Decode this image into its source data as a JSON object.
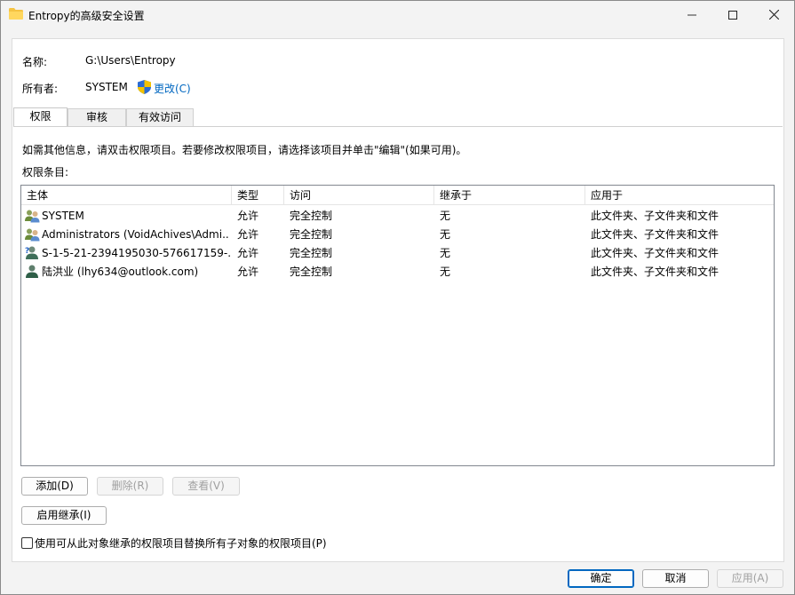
{
  "window": {
    "title": "Entropy的高级安全设置",
    "folder_icon": "folder-icon",
    "minimize_icon": "minimize-icon",
    "maximize_icon": "maximize-icon",
    "close_icon": "close-icon"
  },
  "header": {
    "name_label": "名称:",
    "name_value": "G:\\Users\\Entropy",
    "owner_label": "所有者:",
    "owner_value": "SYSTEM",
    "change_link": "更改(C)",
    "shield_icon": "uac-shield-icon"
  },
  "tabs": [
    {
      "label": "权限",
      "active": true
    },
    {
      "label": "审核",
      "active": false
    },
    {
      "label": "有效访问",
      "active": false
    }
  ],
  "permissions": {
    "info_text": "如需其他信息，请双击权限项目。若要修改权限项目，请选择该项目并单击\"编辑\"(如果可用)。",
    "entries_label": "权限条目:",
    "columns": [
      "主体",
      "类型",
      "访问",
      "继承于",
      "应用于"
    ],
    "rows": [
      {
        "icon": "group-users-icon",
        "principal": "SYSTEM",
        "type": "允许",
        "access": "完全控制",
        "inherited": "无",
        "applies": "此文件夹、子文件夹和文件"
      },
      {
        "icon": "group-users-icon",
        "principal": "Administrators (VoidAchives\\Admi...",
        "type": "允许",
        "access": "完全控制",
        "inherited": "无",
        "applies": "此文件夹、子文件夹和文件"
      },
      {
        "icon": "unknown-user-icon",
        "principal": "S-1-5-21-2394195030-576617159-...",
        "type": "允许",
        "access": "完全控制",
        "inherited": "无",
        "applies": "此文件夹、子文件夹和文件"
      },
      {
        "icon": "user-icon",
        "principal": "陆洪业 (lhy634@outlook.com)",
        "type": "允许",
        "access": "完全控制",
        "inherited": "无",
        "applies": "此文件夹、子文件夹和文件"
      }
    ],
    "add_button": "添加(D)",
    "remove_button": "删除(R)",
    "view_button": "查看(V)",
    "enable_inheritance_button": "启用继承(I)",
    "replace_checkbox_label": "使用可从此对象继承的权限项目替换所有子对象的权限项目(P)",
    "replace_checked": false
  },
  "footer": {
    "ok": "确定",
    "cancel": "取消",
    "apply": "应用(A)"
  },
  "colors": {
    "accent": "#0067c0",
    "window_bg": "#f3f3f3",
    "disabled_text": "#a0a0a0"
  }
}
